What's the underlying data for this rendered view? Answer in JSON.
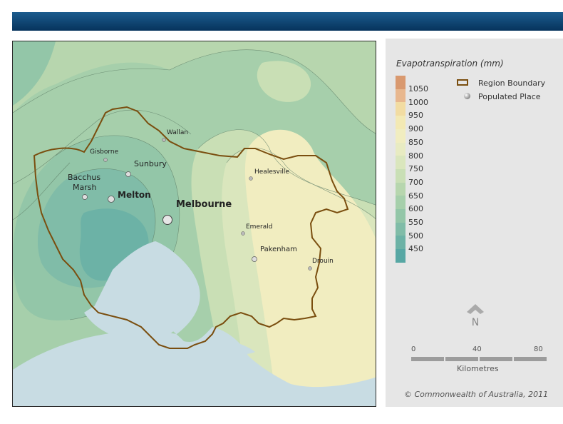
{
  "map": {
    "places": [
      {
        "label": "Wallan",
        "size": "small"
      },
      {
        "label": "Gisborne",
        "size": "small"
      },
      {
        "label": "Sunbury",
        "size": "medium"
      },
      {
        "label": "Bacchus",
        "label2": "Marsh",
        "size": "medium"
      },
      {
        "label": "Melton",
        "size": "large"
      },
      {
        "label": "Melbourne",
        "size": "capital"
      },
      {
        "label": "Healesville",
        "size": "small"
      },
      {
        "label": "Emerald",
        "size": "small"
      },
      {
        "label": "Pakenham",
        "size": "medium"
      },
      {
        "label": "Drouin",
        "size": "small"
      }
    ],
    "colors": {
      "sea": "#c8dce3",
      "boundary": "#7a4e0f"
    }
  },
  "legend": {
    "title": "Evapotranspiration (mm)",
    "scale": [
      {
        "label": "1050",
        "color": "#d9996f"
      },
      {
        "label": "1000",
        "color": "#e8b78e"
      },
      {
        "label": "950",
        "color": "#f2dca2"
      },
      {
        "label": "900",
        "color": "#f3e9b4"
      },
      {
        "label": "850",
        "color": "#f1edc0"
      },
      {
        "label": "800",
        "color": "#e8ebc2"
      },
      {
        "label": "750",
        "color": "#dae6bd"
      },
      {
        "label": "700",
        "color": "#c9dfb5"
      },
      {
        "label": "650",
        "color": "#b7d6ae"
      },
      {
        "label": "600",
        "color": "#a6cfab"
      },
      {
        "label": "550",
        "color": "#93c6a8"
      },
      {
        "label": "500",
        "color": "#80bca8"
      },
      {
        "label": "450",
        "color": "#6cb2a6"
      },
      {
        "label": "",
        "color": "#57a7a4"
      }
    ],
    "boundary_label": "Region Boundary",
    "place_label": "Populated Place"
  },
  "north": {
    "letter": "N"
  },
  "scalebar": {
    "ticks": [
      "0",
      "40",
      "80"
    ],
    "unit": "Kilometres"
  },
  "copyright": "© Commonwealth of Australia, 2011"
}
